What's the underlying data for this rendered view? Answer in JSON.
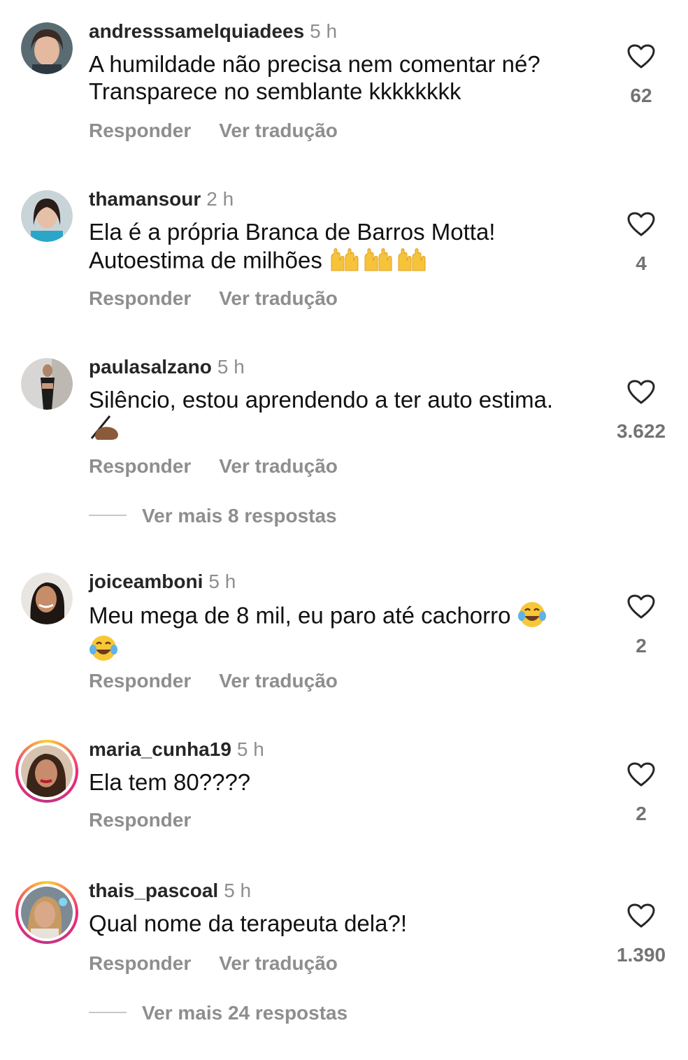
{
  "comments": [
    {
      "username": "andresssamelquiadees",
      "time": "5 h",
      "text_lines": [
        "A humildade não precisa nem comentar né?",
        "Transparece no semblante kkkkkkkk"
      ],
      "likes": "62",
      "reply_label": "Responder",
      "translate_label": "Ver tradução"
    },
    {
      "username": "thamansour",
      "time": "2 h",
      "text_lines": [
        "Ela é a própria Branca de Barros Motta!",
        "Autoestima de milhões"
      ],
      "likes": "4",
      "reply_label": "Responder",
      "translate_label": "Ver tradução"
    },
    {
      "username": "paulasalzano",
      "time": "5 h",
      "text_lines": [
        "Silêncio, estou aprendendo a ter auto estima."
      ],
      "likes": "3.622",
      "reply_label": "Responder",
      "translate_label": "Ver tradução",
      "more_replies": "Ver mais 8 respostas"
    },
    {
      "username": "joiceamboni",
      "time": "5 h",
      "text_lines": [
        "Meu mega de 8 mil, eu paro até cachorro"
      ],
      "likes": "2",
      "reply_label": "Responder",
      "translate_label": "Ver tradução"
    },
    {
      "username": "maria_cunha19",
      "time": "5 h",
      "text_lines": [
        "Ela tem 80????"
      ],
      "likes": "2",
      "reply_label": "Responder"
    },
    {
      "username": "thais_pascoal",
      "time": "5 h",
      "text_lines": [
        "Qual nome da terapeuta dela?!"
      ],
      "likes": "1.390",
      "reply_label": "Responder",
      "translate_label": "Ver tradução",
      "more_replies": "Ver mais 24 respostas"
    }
  ],
  "icons": {
    "like": "heart-outline-icon",
    "emoji_raised_hands": "raising-hands-emoji",
    "emoji_writing": "writing-hand-emoji",
    "emoji_laugh": "tears-of-joy-emoji"
  },
  "colors": {
    "secondary_text": "#8e8e8e",
    "username": "#262626",
    "story_ring": "#ee2a7b"
  }
}
